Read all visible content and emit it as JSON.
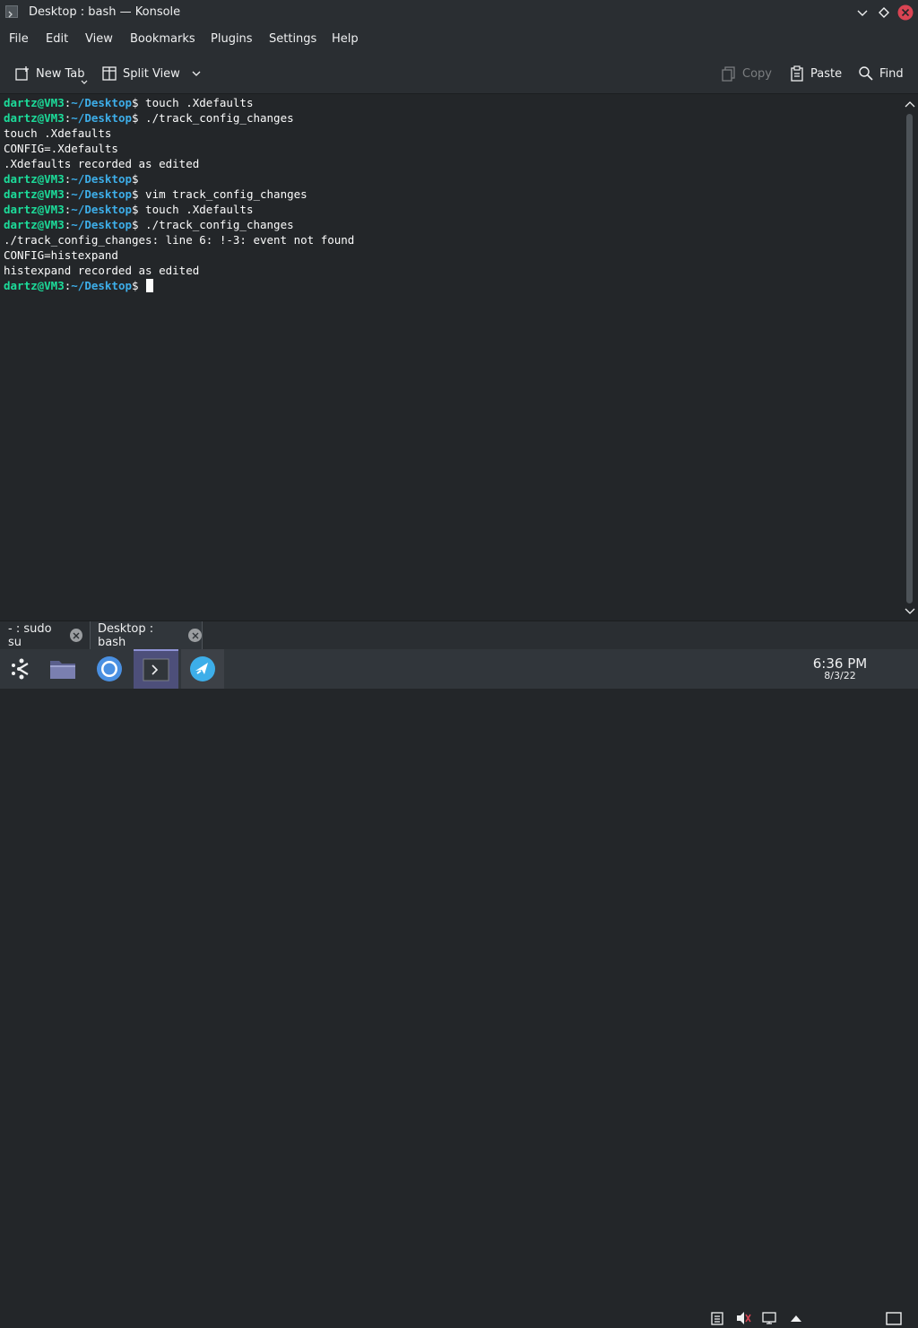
{
  "window": {
    "title": "Desktop : bash — Konsole"
  },
  "menu": [
    "File",
    "Edit",
    "View",
    "Bookmarks",
    "Plugins",
    "Settings",
    "Help"
  ],
  "toolbar": {
    "new_tab": "New Tab",
    "split_view": "Split View",
    "copy": "Copy",
    "paste": "Paste",
    "find": "Find"
  },
  "terminal": {
    "prompt": {
      "user_host": "dartz@VM3",
      "sep": ":",
      "path": "~/Desktop",
      "sigil": "$"
    },
    "lines": [
      {
        "type": "prompt",
        "cmd": " touch .Xdefaults"
      },
      {
        "type": "prompt",
        "cmd": " ./track_config_changes"
      },
      {
        "type": "output",
        "text": "touch .Xdefaults"
      },
      {
        "type": "output",
        "text": "CONFIG=.Xdefaults"
      },
      {
        "type": "output",
        "text": ".Xdefaults recorded as edited"
      },
      {
        "type": "prompt",
        "cmd": ""
      },
      {
        "type": "prompt",
        "cmd": " vim track_config_changes"
      },
      {
        "type": "prompt",
        "cmd": " touch .Xdefaults"
      },
      {
        "type": "prompt",
        "cmd": " ./track_config_changes"
      },
      {
        "type": "output",
        "text": "./track_config_changes: line 6: !-3: event not found"
      },
      {
        "type": "output",
        "text": "CONFIG=histexpand"
      },
      {
        "type": "output",
        "text": "histexpand recorded as edited"
      },
      {
        "type": "prompt",
        "cmd": " ",
        "cursor": true
      }
    ]
  },
  "tabs": [
    {
      "label": "- : sudo su"
    },
    {
      "label": "Desktop : bash",
      "active": true
    }
  ],
  "taskbar": {
    "apps": [
      "application-launcher-icon",
      "file-manager-icon",
      "chromium-icon",
      "konsole-icon",
      "kde-connect-icon"
    ],
    "clock": {
      "time": "6:36 PM",
      "date": "8/3/22"
    }
  },
  "colors": {
    "prompt_user": "#1cdc9a",
    "prompt_path": "#3daee9",
    "accent": "#3daee9",
    "close_button": "#da4453"
  }
}
